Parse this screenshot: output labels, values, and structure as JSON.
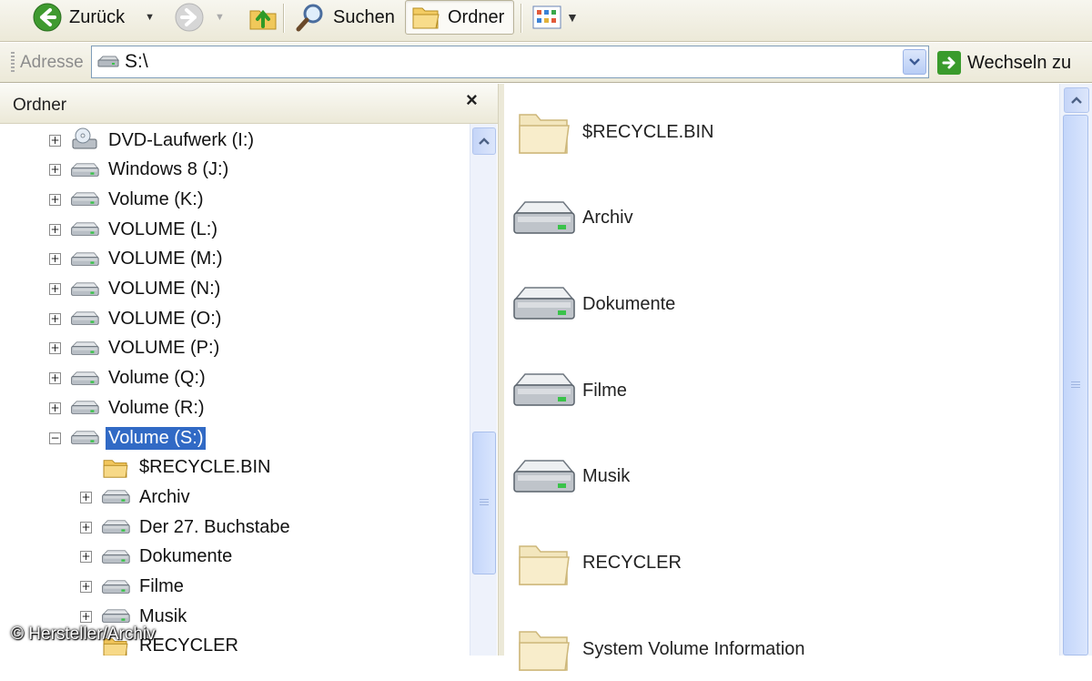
{
  "toolbar": {
    "back_label": "Zurück",
    "search_label": "Suchen",
    "folders_label": "Ordner"
  },
  "address": {
    "label": "Adresse",
    "value": "S:\\",
    "go_label": "Wechseln zu"
  },
  "tree": {
    "title": "Ordner",
    "close_glyph": "×",
    "items": [
      {
        "label": "DVD-Laufwerk (I:)",
        "icon": "dvd-drive-icon",
        "expander": "+",
        "level": 0,
        "selected": false
      },
      {
        "label": "Windows 8 (J:)",
        "icon": "drive-icon",
        "expander": "+",
        "level": 0,
        "selected": false
      },
      {
        "label": "Volume (K:)",
        "icon": "drive-icon",
        "expander": "+",
        "level": 0,
        "selected": false
      },
      {
        "label": "VOLUME (L:)",
        "icon": "drive-icon",
        "expander": "+",
        "level": 0,
        "selected": false
      },
      {
        "label": "VOLUME (M:)",
        "icon": "drive-icon",
        "expander": "+",
        "level": 0,
        "selected": false
      },
      {
        "label": "VOLUME (N:)",
        "icon": "drive-icon",
        "expander": "+",
        "level": 0,
        "selected": false
      },
      {
        "label": "VOLUME (O:)",
        "icon": "drive-icon",
        "expander": "+",
        "level": 0,
        "selected": false
      },
      {
        "label": "VOLUME (P:)",
        "icon": "drive-icon",
        "expander": "+",
        "level": 0,
        "selected": false
      },
      {
        "label": "Volume (Q:)",
        "icon": "drive-icon",
        "expander": "+",
        "level": 0,
        "selected": false
      },
      {
        "label": "Volume (R:)",
        "icon": "drive-icon",
        "expander": "+",
        "level": 0,
        "selected": false
      },
      {
        "label": "Volume (S:)",
        "icon": "drive-icon",
        "expander": "−",
        "level": 0,
        "selected": true
      },
      {
        "label": "$RECYCLE.BIN",
        "icon": "folder-icon",
        "expander": "",
        "level": 1,
        "selected": false
      },
      {
        "label": "Archiv",
        "icon": "drive-icon",
        "expander": "+",
        "level": 1,
        "selected": false
      },
      {
        "label": "Der 27. Buchstabe",
        "icon": "drive-icon",
        "expander": "+",
        "level": 1,
        "selected": false
      },
      {
        "label": "Dokumente",
        "icon": "drive-icon",
        "expander": "+",
        "level": 1,
        "selected": false
      },
      {
        "label": "Filme",
        "icon": "drive-icon",
        "expander": "+",
        "level": 1,
        "selected": false
      },
      {
        "label": "Musik",
        "icon": "drive-icon",
        "expander": "+",
        "level": 1,
        "selected": false
      },
      {
        "label": "RECYCLER",
        "icon": "folder-icon",
        "expander": "",
        "level": 1,
        "selected": false
      }
    ]
  },
  "content": {
    "items": [
      {
        "label": "$RECYCLE.BIN",
        "icon": "folder-icon"
      },
      {
        "label": "Archiv",
        "icon": "drive-icon"
      },
      {
        "label": "Dokumente",
        "icon": "drive-icon"
      },
      {
        "label": "Filme",
        "icon": "drive-icon"
      },
      {
        "label": "Musik",
        "icon": "drive-icon"
      },
      {
        "label": "RECYCLER",
        "icon": "folder-icon"
      },
      {
        "label": "System Volume Information",
        "icon": "folder-icon"
      }
    ]
  },
  "copyright": "© Hersteller/Archiv",
  "colors": {
    "selection": "#316ac5",
    "toolbar_bg": "#ece9d8",
    "scrollbar": "#c4d6fa",
    "go_green": "#3a9b2c"
  }
}
